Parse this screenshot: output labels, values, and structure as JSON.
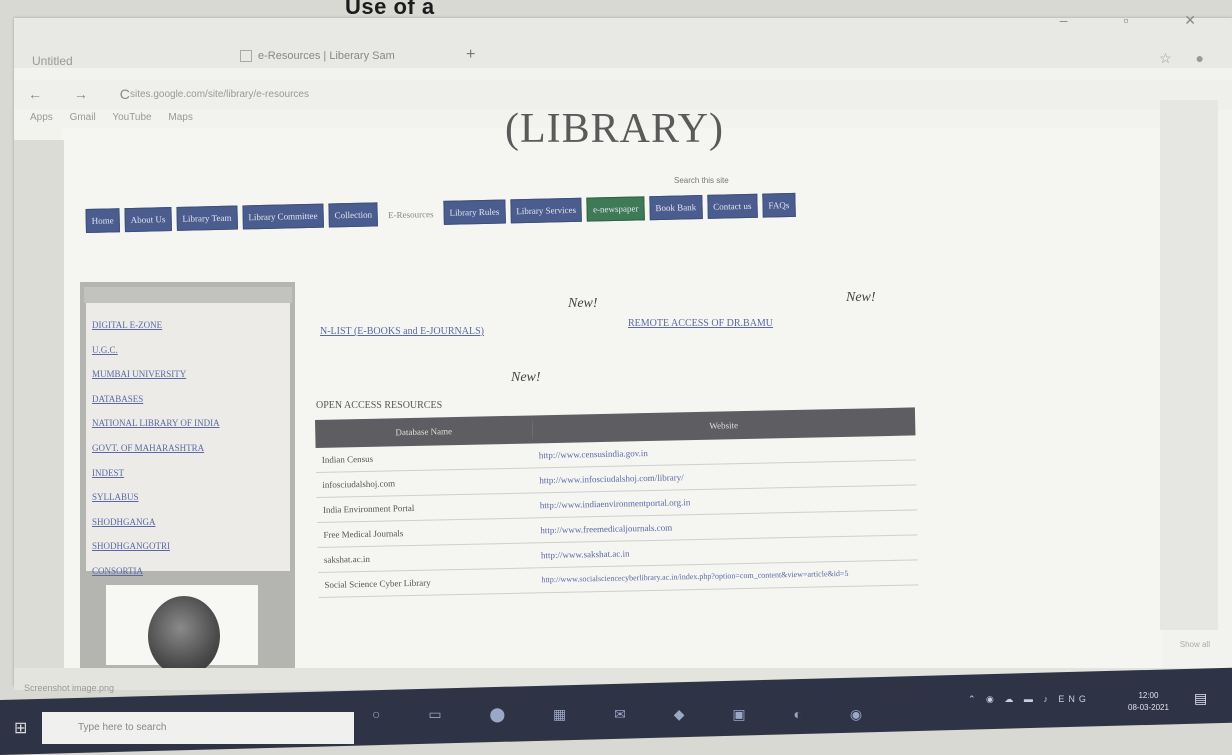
{
  "caption_top": "Use of a",
  "browser": {
    "tabs": [
      {
        "label": "Untitled"
      },
      {
        "label": "e-Resources | Liberary Sam"
      }
    ],
    "new_tab": "+",
    "window_controls": "– ▫ ✕",
    "nav_icons": "← → C",
    "url": "sites.google.com/site/library/e-resources",
    "bookmarks": [
      "Apps",
      "Gmail",
      "YouTube",
      "Maps"
    ],
    "ext_icons": "☆ ●",
    "download_item": "Screenshot image.png",
    "show_all": "Show all"
  },
  "page": {
    "title": "(LIBRARY)",
    "subtitle": "Search this site",
    "menu": [
      {
        "label": "Home",
        "style": "blue"
      },
      {
        "label": "About Us",
        "style": "blue"
      },
      {
        "label": "Library Team",
        "style": "blue"
      },
      {
        "label": "Library Committee",
        "style": "blue"
      },
      {
        "label": "Collection",
        "style": "blue"
      },
      {
        "label": "E-Resources",
        "style": "plain"
      },
      {
        "label": "Library Rules",
        "style": "blue"
      },
      {
        "label": "Library Services",
        "style": "blue"
      },
      {
        "label": "e-newspaper",
        "style": "green"
      },
      {
        "label": "Book Bank",
        "style": "blue"
      },
      {
        "label": "Contact us",
        "style": "blue"
      },
      {
        "label": "FAQs",
        "style": "blue"
      }
    ],
    "sidebar_links": [
      "DIGITAL E-ZONE",
      "U.G.C.",
      "MUMBAI UNIVERSITY",
      "DATABASES",
      "NATIONAL LIBRARY OF INDIA",
      "GOVT. OF MAHARASHTRA",
      "INDEST",
      "SYLLABUS",
      "SHODHGANGA",
      "SHODHGANGOTRI",
      "CONSORTIA"
    ],
    "new_badge": "New!",
    "links": {
      "n_list": "N-LIST (E-BOOKS and E-JOURNALS)",
      "remote_access": "REMOTE ACCESS OF DR.BAMU"
    },
    "open_access_heading": "OPEN ACCESS RESOURCES",
    "table": {
      "headers": [
        "Database Name",
        "Website"
      ],
      "rows": [
        {
          "name": "Indian Census",
          "site": "http://www.censusindia.gov.in"
        },
        {
          "name": "infosciudalshoj.com",
          "site": "http://www.infosciudalshoj.com/library/"
        },
        {
          "name": "India Environment Portal",
          "site": "http://www.indiaenvironmentportal.org.in"
        },
        {
          "name": "Free Medical Journals",
          "site": "http://www.freemedicaljournals.com"
        },
        {
          "name": "sakshat.ac.in",
          "site": "http://www.sakshat.ac.in"
        },
        {
          "name": "Social Science Cyber Library",
          "site": "http://www.socialsciencecyberlibrary.ac.in/index.php?option=com_content&view=article&id=5"
        }
      ]
    }
  },
  "taskbar": {
    "search_placeholder": "Type here to search",
    "task_icons": "○ ▭ ⬤ ▦ ✉ ◆ ▣ ◐ ◉",
    "tray": "⌃ ◉ ☁ ▬ ♪ ENG",
    "time": "12:00",
    "date": "08-03-2021",
    "notif_icon": "▤"
  }
}
